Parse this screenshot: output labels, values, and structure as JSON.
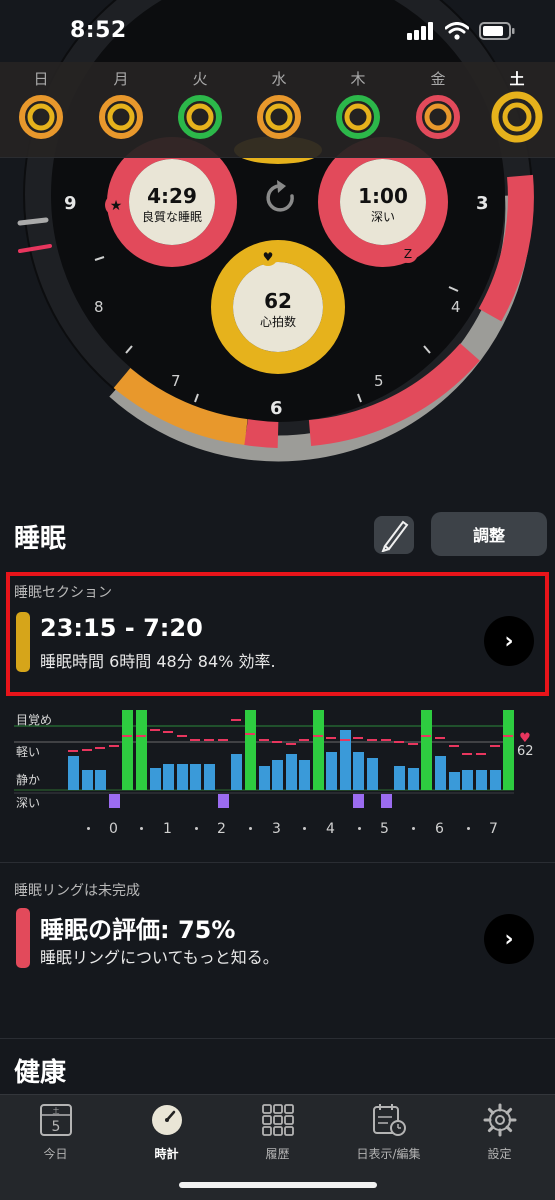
{
  "status_bar": {
    "time": "8:52"
  },
  "week": {
    "days": [
      {
        "label": "日",
        "active": false
      },
      {
        "label": "月",
        "active": false
      },
      {
        "label": "火",
        "active": false
      },
      {
        "label": "水",
        "active": false
      },
      {
        "label": "木",
        "active": false
      },
      {
        "label": "金",
        "active": false
      },
      {
        "label": "土",
        "active": true
      }
    ]
  },
  "clock": {
    "hour_labels": [
      "9",
      "8",
      "7",
      "6",
      "5",
      "4",
      "3"
    ],
    "rings": [
      {
        "value": "4:29",
        "label": "良質な睡眠"
      },
      {
        "value": "1:00",
        "label": "深い"
      },
      {
        "value": "62",
        "label": "心拍数"
      }
    ],
    "colors": {
      "quality": "#e24a5b",
      "deep": "#e24a5b",
      "heart": "#e6b21c",
      "awake_segment": "#e8982c"
    }
  },
  "sleep_section": {
    "title": "睡眠",
    "adjust_label": "調整"
  },
  "session_card": {
    "label": "睡眠セクション",
    "time_range": "23:15 - 7:20",
    "summary": "睡眠時間 6時間 48分 84% 効率.",
    "bar_color": "#d6a51a"
  },
  "hypnogram": {
    "stage_labels": [
      "目覚め",
      "軽い",
      "静か",
      "深い"
    ],
    "heart_value": "62",
    "x_ticks": [
      "0",
      "1",
      "2",
      "3",
      "4",
      "5",
      "6",
      "7"
    ],
    "colors": {
      "awake": "#2ecc40",
      "light_quiet": "#3a9ad9",
      "deep": "#9b6cf0",
      "heart": "#e8365e"
    }
  },
  "ring_card": {
    "label": "睡眠リングは未完成",
    "title": "睡眠の評価: 75%",
    "subtitle": "睡眠リングについてもっと知る。",
    "bar_color": "#e24a5b"
  },
  "health_section": {
    "title": "健康"
  },
  "tabbar": {
    "items": [
      {
        "label": "今日",
        "icon": "calendar-day-icon",
        "badge": "5",
        "badge_top": "土"
      },
      {
        "label": "時計",
        "icon": "clock-icon",
        "active": true
      },
      {
        "label": "履歴",
        "icon": "grid-icon"
      },
      {
        "label": "日表示/編集",
        "icon": "calendar-edit-icon"
      },
      {
        "label": "設定",
        "icon": "gear-icon"
      }
    ]
  }
}
